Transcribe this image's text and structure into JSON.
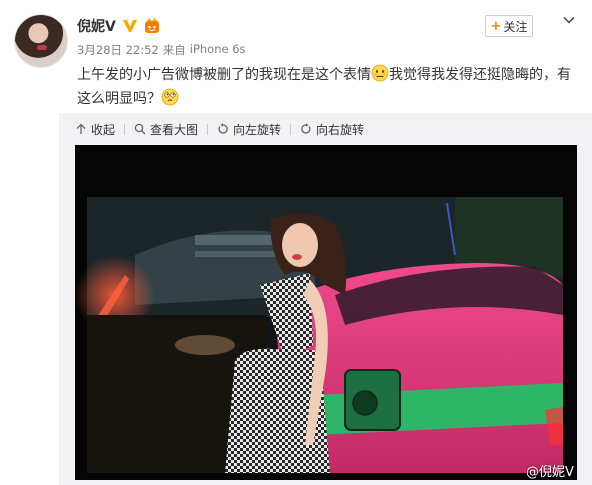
{
  "post": {
    "author_name": "倪妮V",
    "timestamp": "3月28日 22:52",
    "source_prefix": "来自",
    "source_device": "iPhone 6s",
    "text_line1": "上午发的小广告微博被删了的我现在是这个表情",
    "text_line1b": "我觉得我发得还挺隐晦的，有",
    "text_line2": "这么明显吗？"
  },
  "actions": {
    "follow_plus": "+",
    "follow_label": "关注"
  },
  "media_toolbar": {
    "collapse": "收起",
    "view_large": "查看大图",
    "rotate_left": "向左旋转",
    "rotate_right": "向右旋转"
  },
  "photo": {
    "watermark": "@倪妮V"
  },
  "colors": {
    "accent": "#ff8200",
    "verified": "#ffa500",
    "car_pink": "#e6327a",
    "car_green": "#2fb567"
  },
  "icons": [
    "verified-v-icon",
    "member-icon",
    "chevron-down-icon",
    "collapse-arrow-icon",
    "magnifier-icon",
    "rotate-left-icon",
    "rotate-right-icon",
    "awkward-emoji-icon",
    "thinking-emoji-icon"
  ]
}
